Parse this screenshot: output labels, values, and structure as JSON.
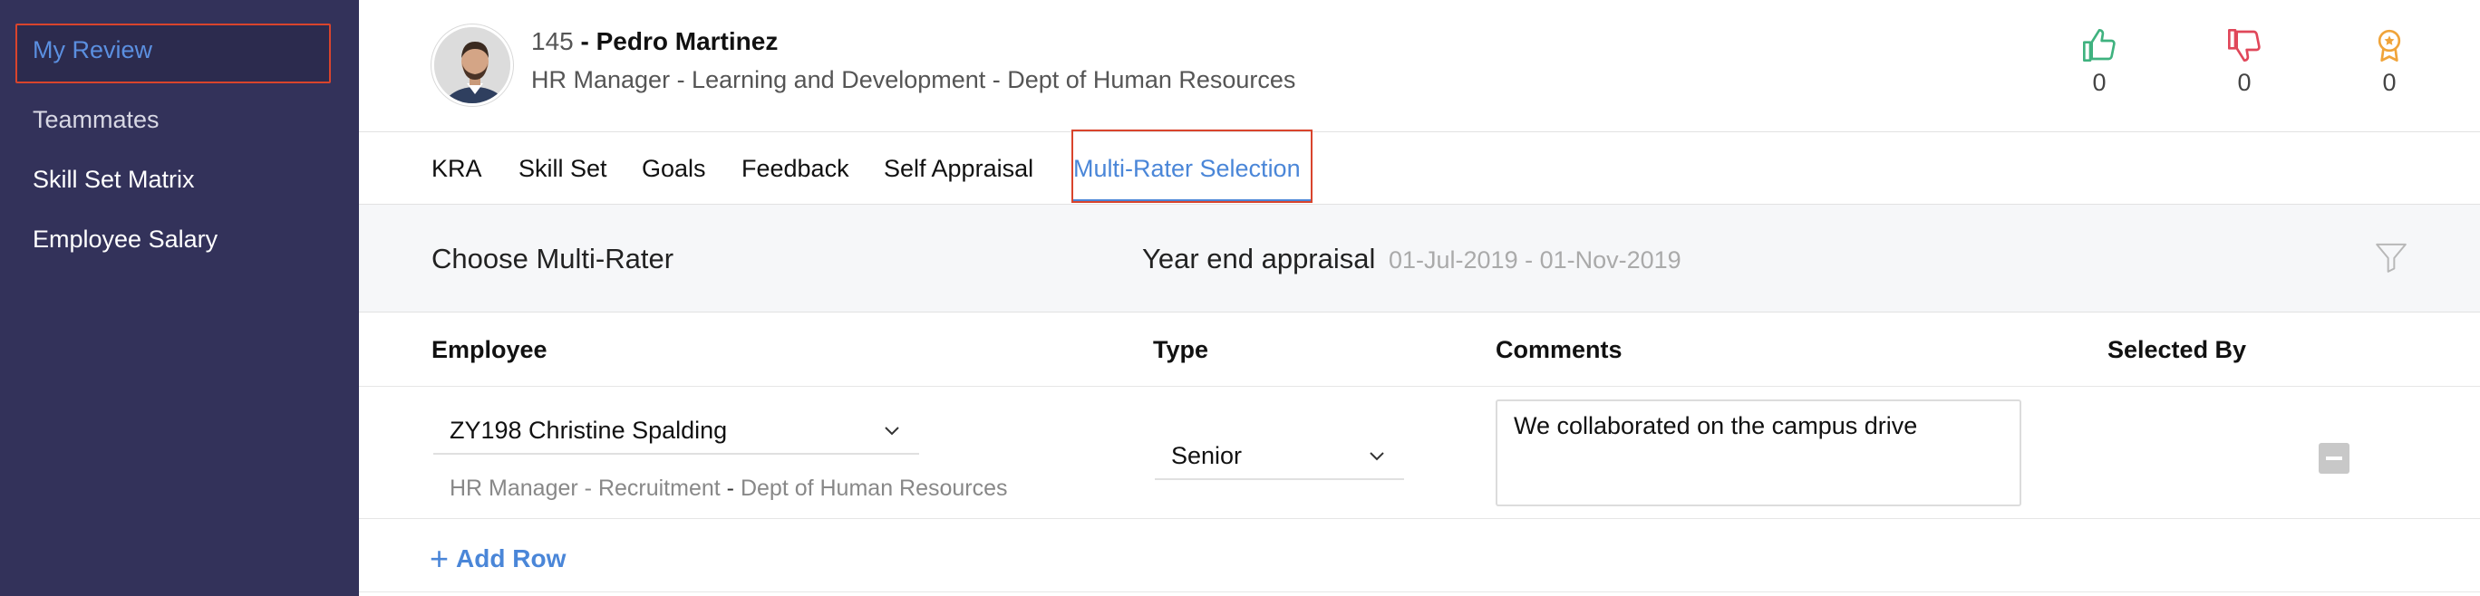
{
  "sidebar": {
    "items": [
      {
        "label": "My Review"
      },
      {
        "label": "Teammates"
      },
      {
        "label": "Skill Set Matrix"
      },
      {
        "label": "Employee Salary"
      }
    ]
  },
  "employee": {
    "id": "145",
    "name_prefix": "- ",
    "name": "Pedro Martinez",
    "role_line": "HR Manager - Learning and Development - Dept of Human Resources"
  },
  "stats": {
    "likes": "0",
    "dislikes": "0",
    "awards": "0"
  },
  "tabs": [
    {
      "label": "KRA"
    },
    {
      "label": "Skill Set"
    },
    {
      "label": "Goals"
    },
    {
      "label": "Feedback"
    },
    {
      "label": "Self Appraisal"
    },
    {
      "label": "Multi-Rater Selection"
    }
  ],
  "section": {
    "title": "Choose Multi-Rater",
    "cycle_name": "Year end appraisal",
    "cycle_range": "01-Jul-2019 - 01-Nov-2019"
  },
  "table": {
    "headers": [
      "Employee",
      "Type",
      "Comments",
      "Selected By"
    ],
    "rows": [
      {
        "employee": "ZY198 Christine Spalding",
        "employee_role": "HR Manager - Recruitment",
        "separator": "-",
        "employee_dept": "Dept of Human Resources",
        "type": "Senior",
        "comment": "We collaborated on the campus drive",
        "selected_by": ""
      }
    ],
    "add_row_label": "Add Row"
  },
  "colors": {
    "sidebar_bg": "#33325a",
    "accent_blue": "#4a86d8",
    "highlight_red": "#d9442c",
    "like_green": "#3fb27f",
    "dislike_red": "#e0475a",
    "award_orange": "#f0a43a"
  },
  "icons": {
    "like": "thumbs-up-icon",
    "dislike": "thumbs-down-icon",
    "award": "award-badge-icon",
    "filter": "filter-icon",
    "chevron": "chevron-down-icon",
    "remove": "minus-square-icon",
    "add": "plus-icon"
  }
}
